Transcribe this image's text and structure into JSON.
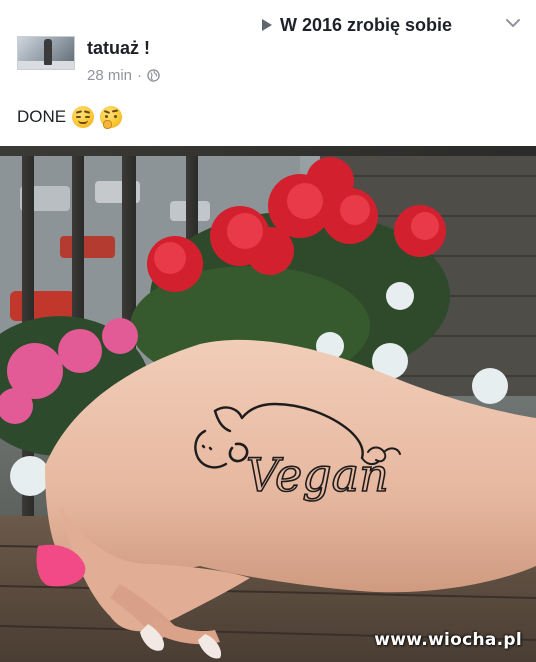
{
  "post": {
    "title_part1": "W 2016 zrobię sobie",
    "title_part2": "tatuaż !",
    "time": "28 min",
    "separator": "·",
    "text": "DONE"
  },
  "icons": {
    "share_arrow": "right-triangle-icon",
    "menu": "chevron-down-icon",
    "privacy": "globe-icon",
    "emoji_1": "relieved-face-emoji",
    "emoji_2": "thinking-face-emoji"
  },
  "photo": {
    "tattoo_text": "Vegan",
    "watermark": "www.wiocha.pl"
  },
  "colors": {
    "text": "#1d2129",
    "meta": "#90949c",
    "watermark": "#ffffff"
  }
}
